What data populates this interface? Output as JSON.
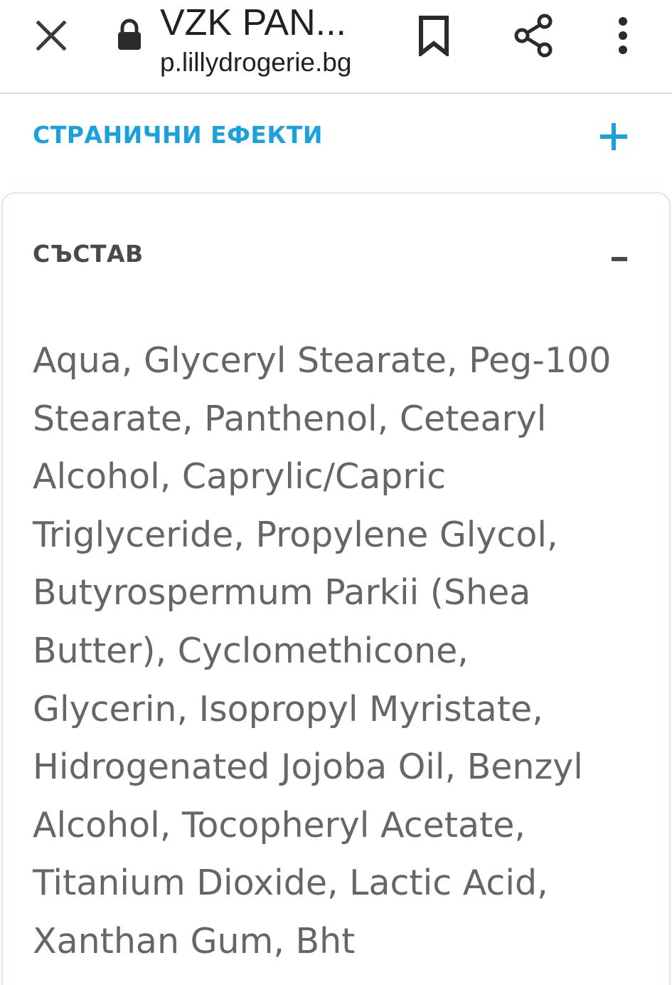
{
  "browser": {
    "title": "VZK PAN...",
    "url": "p.lillydrogerie.bg",
    "icons": {
      "close": "close-icon",
      "lock": "lock-icon",
      "bookmark": "bookmark-icon",
      "share": "share-icon",
      "more": "more-vert-icon"
    }
  },
  "sections": {
    "side_effects": {
      "label": "СТРАНИЧНИ ЕФЕКТИ",
      "toggle_icon": "plus-icon",
      "color": "#1ba1dd"
    },
    "composition": {
      "label": "СЪСТАВ",
      "toggle_icon": "minus-icon",
      "lines": [
        "Aqua, Glyceryl Stearate, Peg-100",
        "Stearate, Panthenol, Cetearyl",
        "Alcohol, Caprylic/Capric",
        "Triglyceride, Propylene Glycol,",
        "Butyrospermum Parkii (Shea",
        "Butter), Cyclomethicone,",
        "Glycerin, Isopropyl Myristate,",
        "Hidrogenated Jojoba Oil, Benzyl",
        "Alcohol, Tocopheryl Acetate,",
        "Titanium Dioxide, Lactic Acid,",
        "Xanthan Gum, Bht"
      ]
    }
  }
}
